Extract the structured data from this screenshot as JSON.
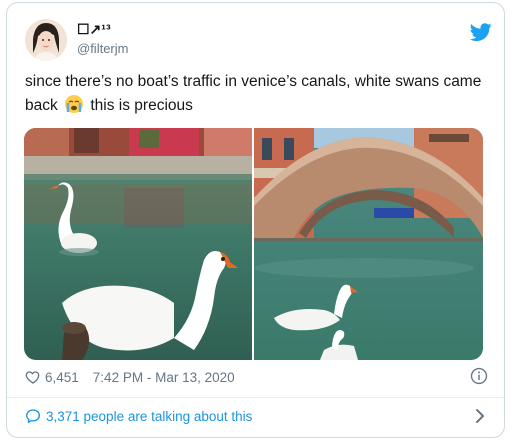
{
  "user": {
    "display_name": "☐↗¹³",
    "handle": "@filterjm"
  },
  "tweet": {
    "text_before_emoji": "since there’s no boat’s traffic in venice’s canals, white swans came back",
    "text_after_emoji": "this is precious",
    "emoji_icon": "crying-face-emoji",
    "photos": [
      {
        "icon": "swans-canal-photo"
      },
      {
        "icon": "bridge-canal-swans-photo"
      }
    ]
  },
  "stats": {
    "likes": "6,451",
    "timestamp": "7:42 PM - Mar 13, 2020"
  },
  "footer": {
    "talking_label": "3,371 people are talking about this"
  },
  "colors": {
    "brand": "#1da1f2",
    "link": "#1b95e0",
    "secondary_text": "#657786",
    "border": "#cfd9de"
  }
}
